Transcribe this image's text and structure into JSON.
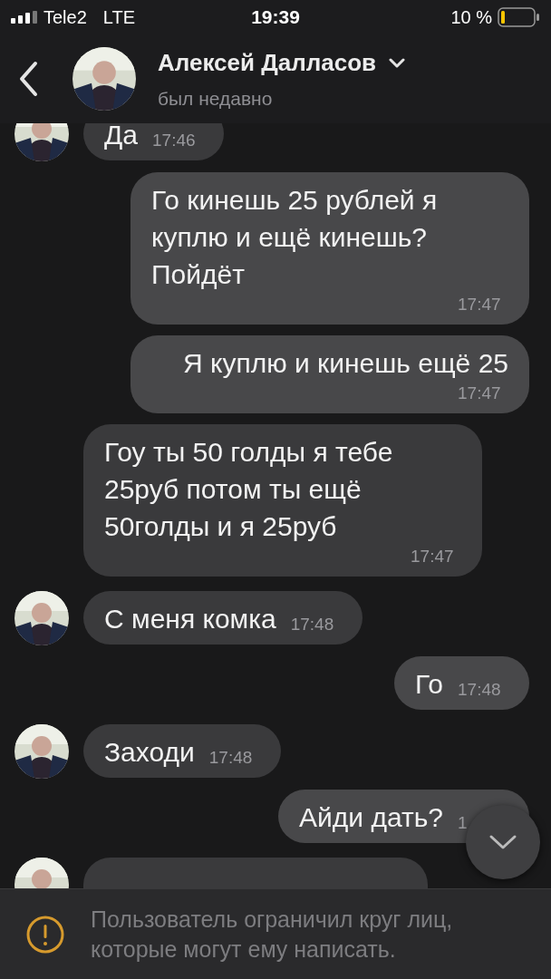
{
  "status_bar": {
    "carrier": "Tele2",
    "network": "LTE",
    "time": "19:39",
    "battery": "10 %"
  },
  "header": {
    "name": "Алексей Далласов",
    "status": "был недавно"
  },
  "messages": [
    {
      "kind": "incoming",
      "avatar": true,
      "text": "Да",
      "time": "17:46"
    },
    {
      "kind": "outgoing",
      "text": "Го кинешь 25 рублей я куплю и ещё кинешь? Пойдёт",
      "time": "17:47"
    },
    {
      "kind": "outgoing",
      "text": "Я куплю и кинешь ещё 25",
      "time": "17:47"
    },
    {
      "kind": "incoming",
      "avatar": false,
      "text": "Гоу ты 50 голды я тебе 25руб потом ты ещё 50голды и я 25руб",
      "time": "17:47"
    },
    {
      "kind": "incoming",
      "avatar": true,
      "text": "С меня комка",
      "time": "17:48"
    },
    {
      "kind": "outgoing",
      "text": "Го",
      "time": "17:48"
    },
    {
      "kind": "incoming",
      "avatar": true,
      "text": "Заходи",
      "time": "17:48"
    },
    {
      "kind": "outgoing",
      "text": "Айди дать?",
      "time": "1"
    },
    {
      "kind": "incoming",
      "avatar": true
    }
  ],
  "notice": "Пользователь ограничил круг лиц, которые могут ему написать."
}
